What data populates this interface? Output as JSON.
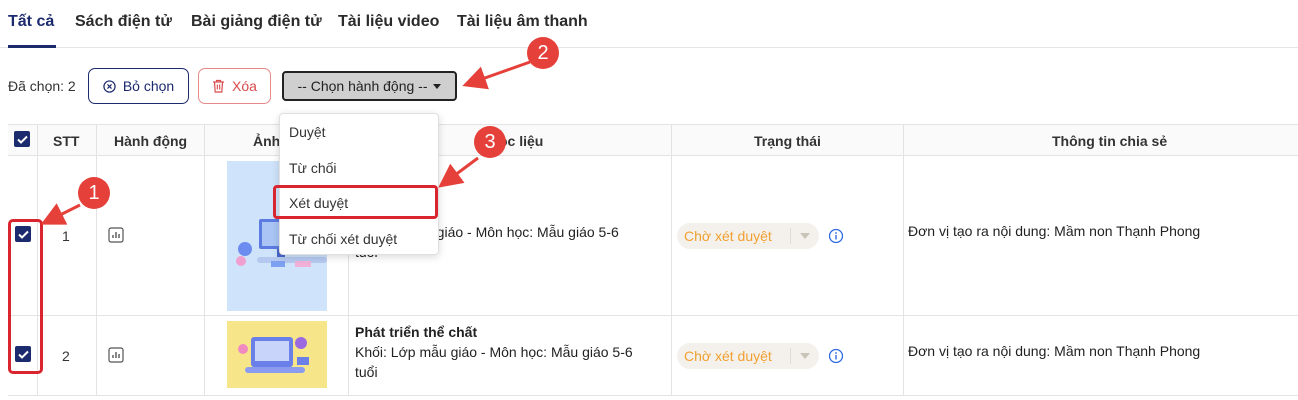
{
  "tabs": [
    {
      "label": "Tất cả",
      "active": true
    },
    {
      "label": "Sách điện tử"
    },
    {
      "label": "Bài giảng điện tử"
    },
    {
      "label": "Tài liệu video"
    },
    {
      "label": "Tài liệu âm thanh"
    }
  ],
  "toolbar": {
    "selected_count_text": "Đã chọn: 2",
    "deselect_label": "Bỏ chọn",
    "delete_label": "Xóa",
    "action_select_label": "-- Chọn hành động --"
  },
  "action_menu": {
    "items": [
      "Duyệt",
      "Từ chối",
      "Xét duyệt",
      "Từ chối xét duyệt"
    ],
    "highlighted_item": "Xét duyệt"
  },
  "table": {
    "headers": {
      "stt": "STT",
      "action": "Hành động",
      "image": "Ảnh",
      "material": "ọc liệu",
      "status": "Trạng thái",
      "share_info": "Thông tin chia sẻ"
    },
    "rows": [
      {
        "checked": true,
        "stt": "1",
        "title": "",
        "desc_line1": "u giáo - Môn học: Mẫu giáo 5-6",
        "desc_line2": "tuổi",
        "status": "Chờ xét duyệt",
        "share_info": "Đơn vị tạo ra nội dung: Mầm non Thạnh Phong"
      },
      {
        "checked": true,
        "stt": "2",
        "title": "Phát triển thể chất",
        "desc_line1": "Khối: Lớp mẫu giáo - Môn học: Mẫu giáo 5-6",
        "desc_line2": "tuổi",
        "status": "Chờ xét duyệt",
        "share_info": "Đơn vị tạo ra nội dung: Mầm non Thạnh Phong"
      }
    ]
  },
  "annotations": {
    "badge_1": "1",
    "badge_2": "2",
    "badge_3": "3"
  },
  "colors": {
    "primary": "#1c2a6e",
    "danger": "#d94a4a",
    "annotation_red": "#e5403a",
    "status_orange": "#f0a030"
  }
}
